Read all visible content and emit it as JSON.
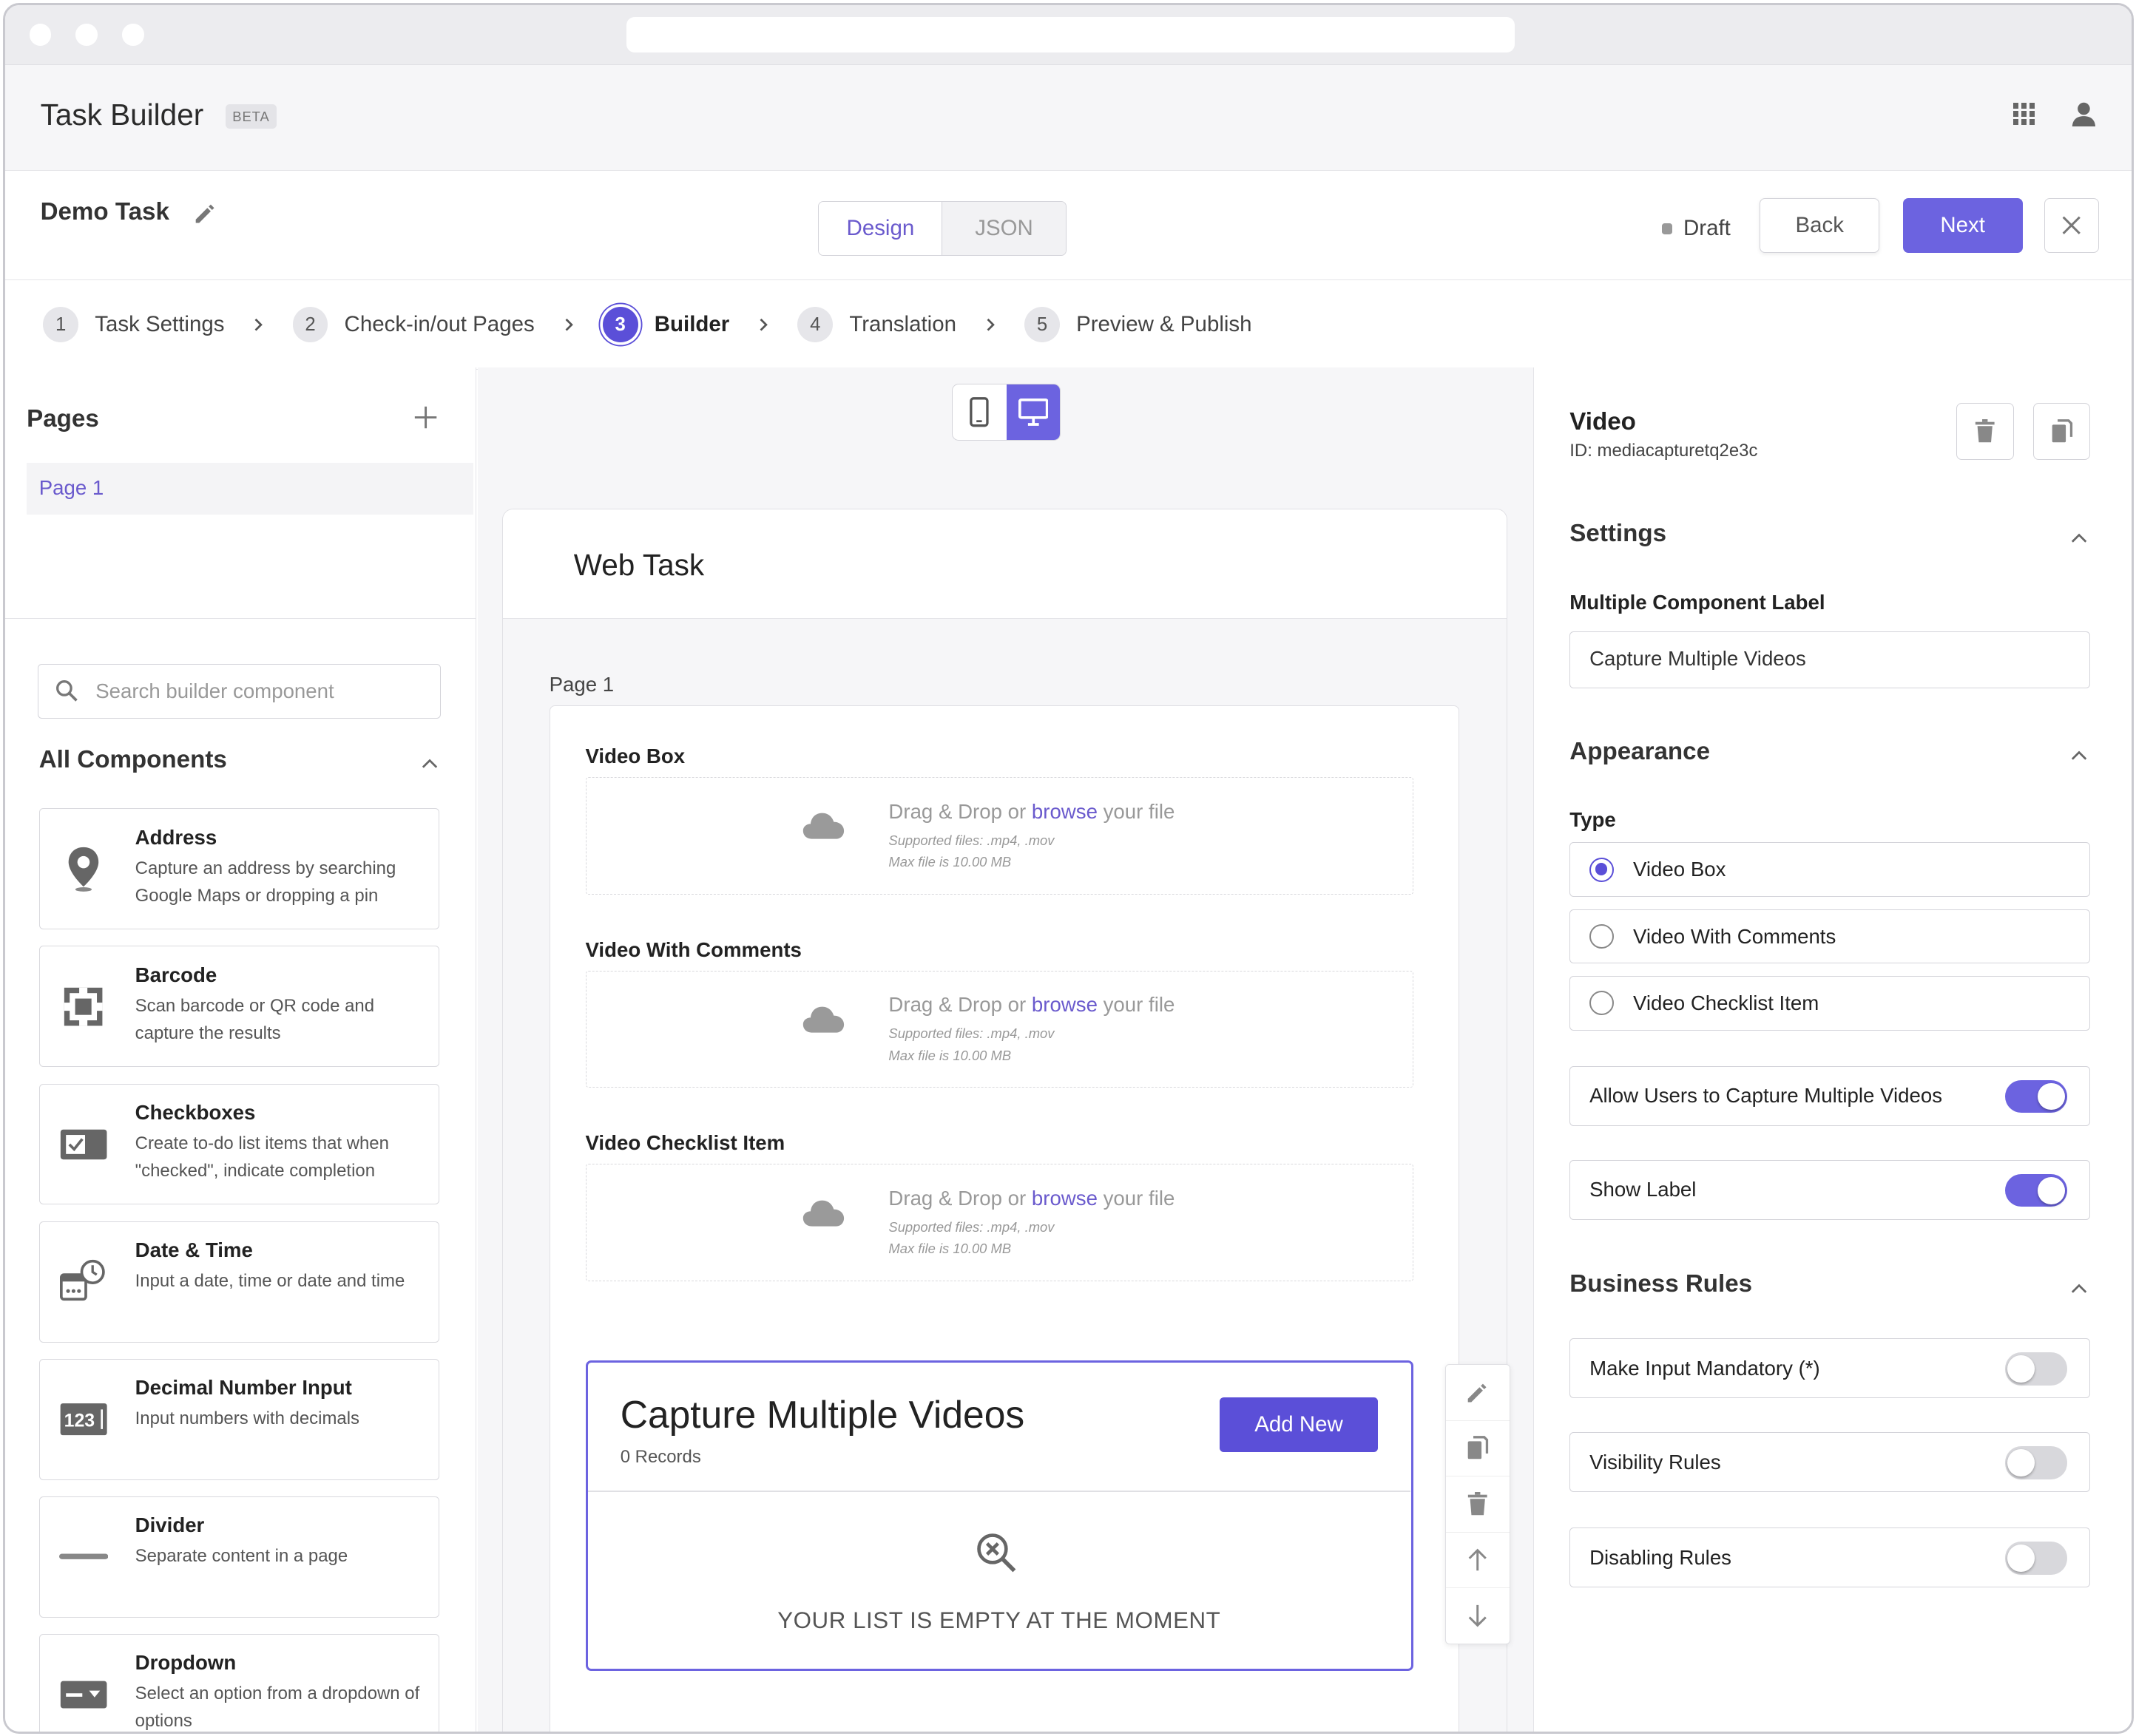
{
  "app": {
    "title": "Task Builder",
    "badge": "BETA"
  },
  "task": {
    "name": "Demo Task",
    "status": "Draft"
  },
  "view_toggle": {
    "design": "Design",
    "json": "JSON"
  },
  "actions": {
    "back": "Back",
    "next": "Next"
  },
  "steps": [
    {
      "num": "1",
      "label": "Task Settings"
    },
    {
      "num": "2",
      "label": "Check-in/out Pages"
    },
    {
      "num": "3",
      "label": "Builder"
    },
    {
      "num": "4",
      "label": "Translation"
    },
    {
      "num": "5",
      "label": "Preview & Publish"
    }
  ],
  "left": {
    "pages_title": "Pages",
    "page_item": "Page 1",
    "search_placeholder": "Search builder component",
    "all_components": "All Components",
    "components": [
      {
        "title": "Address",
        "desc": "Capture an address by searching Google Maps or dropping a pin",
        "icon": "location-pin-icon"
      },
      {
        "title": "Barcode",
        "desc": "Scan barcode or QR code and capture the results",
        "icon": "barcode-scan-icon"
      },
      {
        "title": "Checkboxes",
        "desc": "Create to-do list items that when \"checked\", indicate completion",
        "icon": "checkbox-icon"
      },
      {
        "title": "Date & Time",
        "desc": "Input a date, time or date and time",
        "icon": "calendar-clock-icon"
      },
      {
        "title": "Decimal Number Input",
        "desc": "Input numbers with decimals",
        "icon": "number-input-icon"
      },
      {
        "title": "Divider",
        "desc": "Separate content in a page",
        "icon": "divider-icon"
      },
      {
        "title": "Dropdown",
        "desc": "Select an option from a dropdown of options",
        "icon": "dropdown-icon"
      }
    ]
  },
  "canvas": {
    "web_task_title": "Web Task",
    "page_label": "Page 1",
    "upload": {
      "drag": "Drag & Drop or ",
      "browse": "browse",
      "rest": " your file",
      "supported": "Supported files: .mp4, .mov",
      "max": "Max file is 10.00 MB"
    },
    "video_fields": [
      "Video Box",
      "Video With Comments",
      "Video Checklist Item"
    ],
    "multi": {
      "title": "Capture Multiple Videos",
      "records": "0 Records",
      "add_new": "Add New",
      "empty": "YOUR LIST IS EMPTY AT THE MOMENT"
    }
  },
  "right": {
    "component_title": "Video",
    "component_id": "ID: mediacapturetq2e3c",
    "settings_title": "Settings",
    "multi_label_title": "Multiple Component Label",
    "multi_label_value": "Capture Multiple Videos",
    "appearance_title": "Appearance",
    "type_label": "Type",
    "type_options": [
      "Video Box",
      "Video With Comments",
      "Video Checklist Item"
    ],
    "type_selected": "Video Box",
    "allow_multiple": {
      "label": "Allow Users to Capture Multiple Videos",
      "on": true
    },
    "show_label": {
      "label": "Show Label",
      "on": true
    },
    "business_rules_title": "Business Rules",
    "rules": [
      {
        "label": "Make Input Mandatory (*)",
        "on": false
      },
      {
        "label": "Visibility Rules",
        "on": false
      },
      {
        "label": "Disabling Rules",
        "on": false
      }
    ]
  },
  "colors": {
    "accent": "#6c63e0",
    "accent_dark": "#5b4fd8",
    "border": "#d4d4da"
  }
}
